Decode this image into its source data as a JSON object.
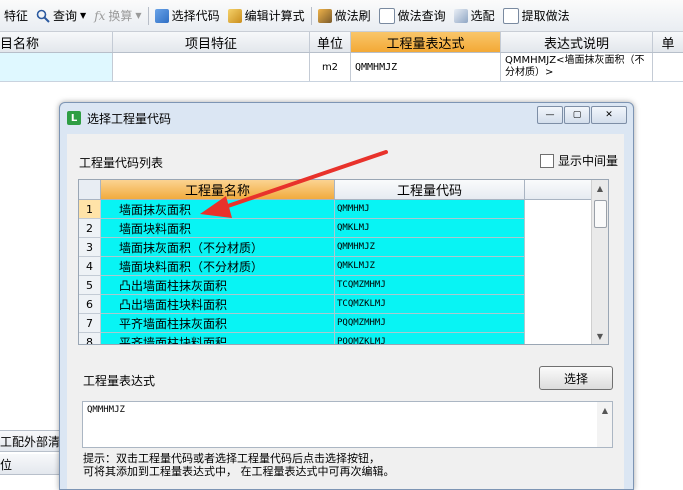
{
  "toolbar": {
    "items": [
      {
        "label": "特征",
        "icon": "none"
      },
      {
        "label": "查询",
        "icon": "search-icon",
        "dropdown": true
      },
      {
        "label": "换算",
        "icon": "fx-icon",
        "dropdown": true,
        "disabled": true
      },
      {
        "label": "选择代码",
        "icon": "select-code-icon"
      },
      {
        "label": "编辑计算式",
        "icon": "edit-formula-icon"
      },
      {
        "label": "做法刷",
        "icon": "brush-icon"
      },
      {
        "label": "做法查询",
        "icon": "query-method-icon"
      },
      {
        "label": "选配",
        "icon": "select-match-icon"
      },
      {
        "label": "提取做法",
        "icon": "extract-method-icon"
      }
    ]
  },
  "bg_table": {
    "headers": [
      "目名称",
      "项目特征",
      "单位",
      "工程量表达式",
      "表达式说明",
      "单"
    ],
    "row": {
      "unit": "m2",
      "expression": "QMMHMJZ",
      "description": "QMMHMJZ<墙面抹灰面积（不分材质）>"
    }
  },
  "bottom": {
    "tab_label": "工配外部清单",
    "header_label": "位"
  },
  "dialog": {
    "title": "选择工程量代码",
    "window_buttons": [
      "—",
      "▢",
      "✕"
    ],
    "list_label": "工程量代码列表",
    "show_middle_label": "显示中间量",
    "show_middle_checked": false,
    "columns": [
      "工程量名称",
      "工程量代码"
    ],
    "rows": [
      {
        "num": "1",
        "name": "墙面抹灰面积",
        "code": "QMMHMJ"
      },
      {
        "num": "2",
        "name": "墙面块料面积",
        "code": "QMKLMJ"
      },
      {
        "num": "3",
        "name": "墙面抹灰面积（不分材质）",
        "code": "QMMHMJZ"
      },
      {
        "num": "4",
        "name": "墙面块料面积（不分材质）",
        "code": "QMKLMJZ"
      },
      {
        "num": "5",
        "name": "凸出墙面柱抹灰面积",
        "code": "TCQMZMHMJ"
      },
      {
        "num": "6",
        "name": "凸出墙面柱块料面积",
        "code": "TCQMZKLMJ"
      },
      {
        "num": "7",
        "name": "平齐墙面柱抹灰面积",
        "code": "PQQMZMHMJ"
      },
      {
        "num": "8",
        "name": "平齐墙面柱块料面积",
        "code": "PQQMZKLMJ"
      }
    ],
    "expr_label": "工程量表达式",
    "select_button": "选择",
    "expr_value": "QMMHMJZ",
    "hint_line1": "提示：双击工程量代码或者选择工程量代码后点击选择按钮，",
    "hint_line2": "可将其添加到工程量表达式中， 在工程量表达式中可再次编辑。"
  },
  "colors": {
    "selected_cell": "#08f4f4",
    "header_highlight": "#f3a936",
    "annotation_arrow": "#e8322b"
  }
}
